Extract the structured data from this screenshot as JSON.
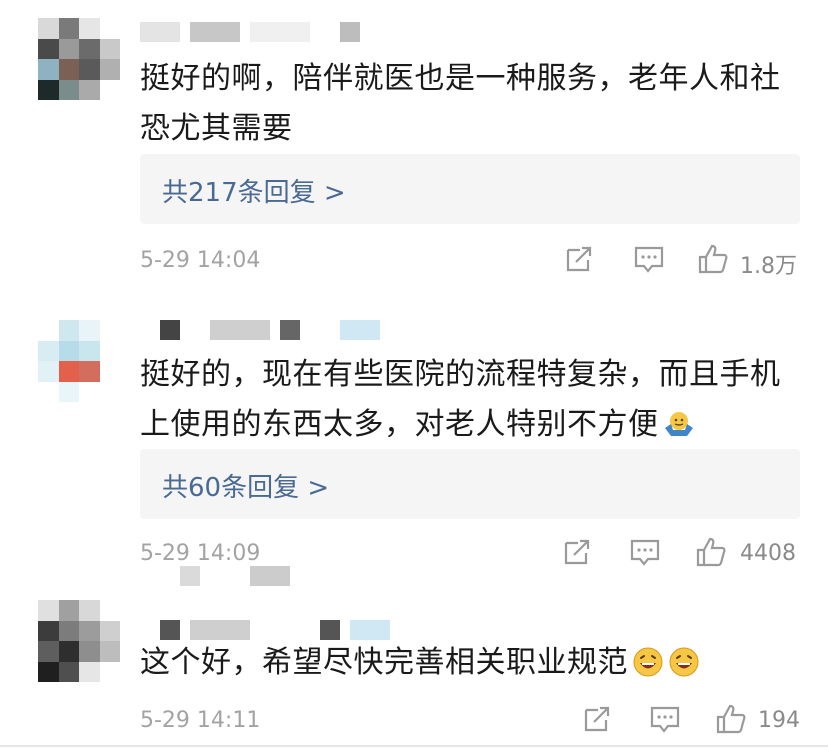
{
  "comments": [
    {
      "text": "挺好的啊，陪伴就医也是一种服务，老年人和社恐尤其需要",
      "replies_label": "共217条回复 >",
      "time": "5-29 14:04",
      "likes": "1.8万"
    },
    {
      "text": "挺好的，现在有些医院的流程特复杂，而且手机上使用的东西太多，对老人特别不方便",
      "replies_label": "共60条回复 >",
      "time": "5-29 14:09",
      "likes": "4408"
    },
    {
      "text": "这个好，希望尽快完善相关职业规范",
      "time": "5-29 14:11",
      "likes": "194"
    }
  ],
  "icons": {
    "share": "share-icon",
    "comment": "comment-icon",
    "like": "thumbs-up-icon"
  },
  "colors": {
    "reply_link": "#4a6a93",
    "meta": "#a3a3a3",
    "reply_bg": "#f5f5f5"
  }
}
